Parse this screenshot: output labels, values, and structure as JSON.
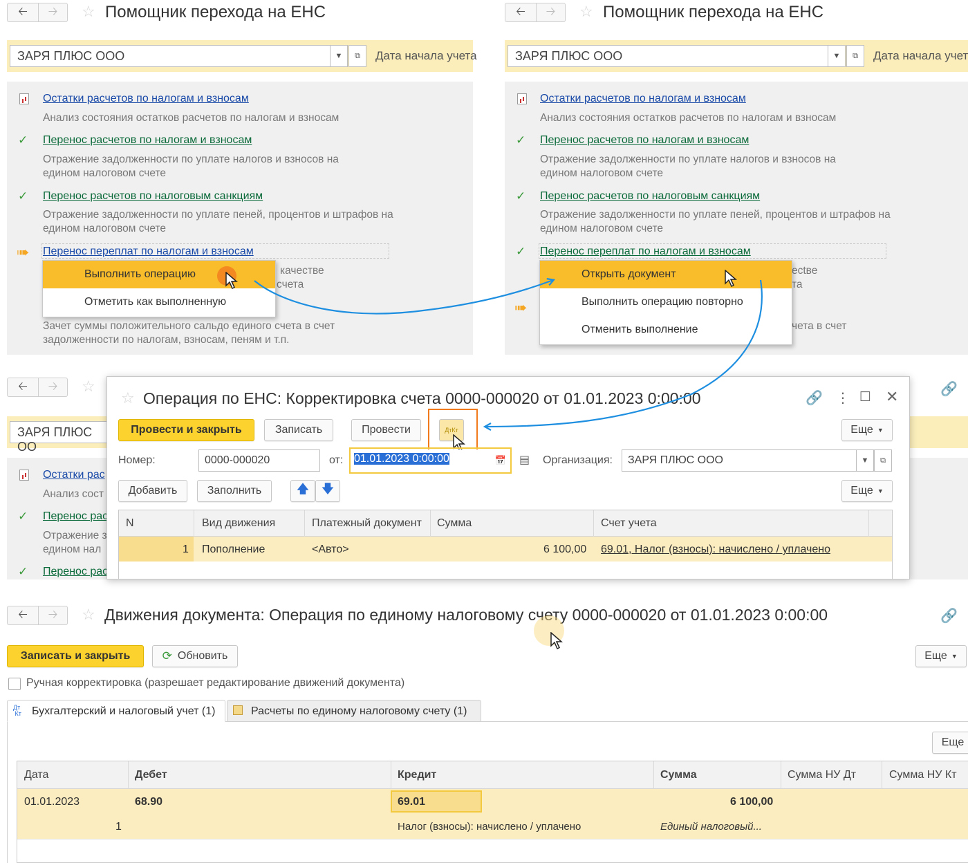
{
  "tl": {
    "title": "Помощник перехода на ЕНС",
    "org": "ЗАРЯ ПЛЮС ООО",
    "date_label": "Дата начала учета",
    "items": [
      {
        "link": "Остатки расчетов по налогам и взносам",
        "desc": "Анализ состояния остатков расчетов по налогам и взносам"
      },
      {
        "link": "Перенос расчетов по налогам и взносам",
        "desc": "Отражение задолженности по уплате налогов и взносов на едином налоговом счете"
      },
      {
        "link": "Перенос расчетов по налоговым санкциям",
        "desc": "Отражение задолженности по уплате пеней, процентов и штрафов на едином налоговом счете"
      },
      {
        "link": "Перенос переплат по налогам и взносам",
        "desc_tail1": "качестве",
        "desc_tail2": "счета"
      },
      {
        "desc": "Зачет суммы положительного сальдо единого счета в счет задолженности по налогам, взносам, пеням и т.п."
      }
    ],
    "menu": [
      "Выполнить операцию",
      "Отметить как выполненную"
    ]
  },
  "tr": {
    "title": "Помощник перехода на ЕНС",
    "org": "ЗАРЯ ПЛЮС ООО",
    "date_label": "Дата начала учета",
    "items": [
      {
        "link": "Остатки расчетов по налогам и взносам",
        "desc": "Анализ состояния остатков расчетов по налогам и взносам"
      },
      {
        "link": "Перенос расчетов по налогам и взносам",
        "desc": "Отражение задолженности по уплате налогов и взносов на едином налоговом счете"
      },
      {
        "link": "Перенос расчетов по налоговым санкциям",
        "desc": "Отражение задолженности по уплате пеней, процентов и штрафов на едином налоговом счете"
      },
      {
        "link": "Перенос переплат по налогам и взносам",
        "desc_tail1": "ectве",
        "desc_tail2": "та"
      },
      {
        "desc_tail": "чета в счет"
      }
    ],
    "menu": [
      "Открыть документ",
      "Выполнить операцию повторно",
      "Отменить выполнение"
    ]
  },
  "bgleft": {
    "org": "ЗАРЯ ПЛЮС ОО",
    "l1": "Остатки рас",
    "d1": "Анализ сост",
    "l2": "Перенос рас",
    "d2a": "Отражение з",
    "d2b": "едином нал",
    "l3": "Перенос рас"
  },
  "op": {
    "title": "Операция по ЕНС: Корректировка счета 0000-000020 от 01.01.2023 0:00:00",
    "btn_post_close": "Провести и закрыть",
    "btn_save": "Записать",
    "btn_post": "Провести",
    "btn_dtkt": "ДтКт",
    "btn_more": "Еще",
    "num_label": "Номер:",
    "num": "0000-000020",
    "from_label": "от:",
    "date": "01.01.2023  0:00:00",
    "org_label": "Организация:",
    "org": "ЗАРЯ ПЛЮС ООО",
    "btn_add": "Добавить",
    "btn_fill": "Заполнить",
    "btn_more2": "Еще",
    "cols": [
      "N",
      "Вид движения",
      "Платежный документ",
      "Сумма",
      "Счет учета"
    ],
    "row": {
      "n": "1",
      "kind": "Пополнение",
      "doc": "<Авто>",
      "sum": "6 100,00",
      "acc": "69.01, Налог (взносы): начислено / уплачено"
    }
  },
  "mv": {
    "title": "Движения документа: Операция по единому налоговому счету 0000-000020 от 01.01.2023 0:00:00",
    "btn_save_close": "Записать и закрыть",
    "btn_refresh": "Обновить",
    "btn_more": "Еще",
    "manual": "Ручная корректировка (разрешает редактирование движений документа)",
    "tab1": "Бухгалтерский и налоговый учет (1)",
    "tab2": "Расчеты по единому налоговому счету (1)",
    "btn_more2": "Еще",
    "cols": [
      "Дата",
      "Дебет",
      "Кредит",
      "Сумма",
      "Сумма НУ Дт",
      "Сумма НУ Кт"
    ],
    "row": {
      "date": "01.01.2023",
      "n": "1",
      "debit": "68.90",
      "credit": "69.01",
      "credit_name": "Налог (взносы): начислено / уплачено",
      "sum": "6 100,00",
      "sum_desc": "Единый налоговый..."
    }
  },
  "colors": {
    "accent": "#f9bc2b",
    "link": "#1a4aa8",
    "arrow": "#1e8fe0",
    "highlight_box": "#f07a1c"
  }
}
